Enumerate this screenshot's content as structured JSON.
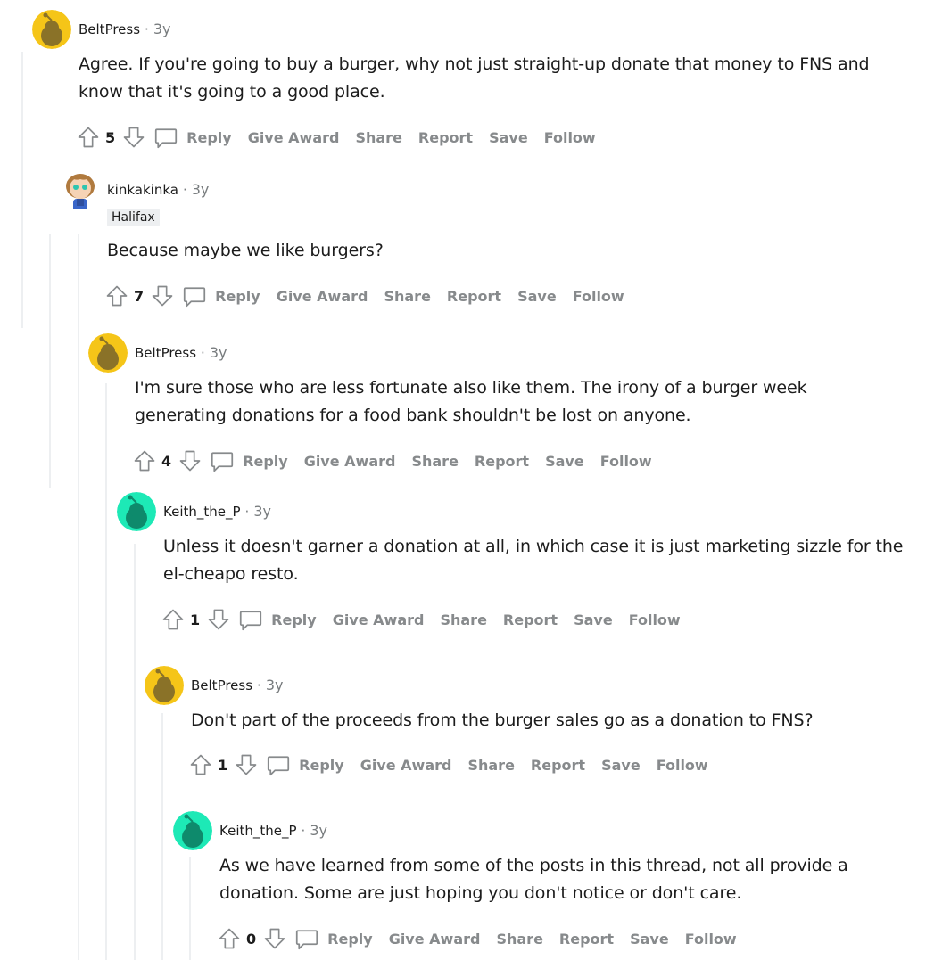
{
  "colors": {
    "avatar_yellow": "#f5c518",
    "avatar_teal": "#1de9b6",
    "thread_line": "#edeff1",
    "action_gray": "#878a8c",
    "meta_gray": "#787c7e"
  },
  "comments": [
    {
      "author": "BeltPress",
      "sep": "·",
      "time": "3y",
      "avatar": "snoo-avatar-yellow",
      "body": "Agree. If you're going to buy a burger, why not just straight-up donate that money to FNS and know that it's going to a good place.",
      "votes": "5",
      "actions": {
        "reply": "Reply",
        "award": "Give Award",
        "share": "Share",
        "report": "Report",
        "save": "Save",
        "follow": "Follow"
      }
    },
    {
      "author": "kinkakinka",
      "sep": "·",
      "time": "3y",
      "avatar": "custom-avatar-girl",
      "flair": "Halifax",
      "body": "Because maybe we like burgers?",
      "votes": "7",
      "actions": {
        "reply": "Reply",
        "award": "Give Award",
        "share": "Share",
        "report": "Report",
        "save": "Save",
        "follow": "Follow"
      }
    },
    {
      "author": "BeltPress",
      "sep": "·",
      "time": "3y",
      "avatar": "snoo-avatar-yellow",
      "body": "I'm sure those who are less fortunate also like them. The irony of a burger week generating donations for a food bank shouldn't be lost on anyone.",
      "votes": "4",
      "actions": {
        "reply": "Reply",
        "award": "Give Award",
        "share": "Share",
        "report": "Report",
        "save": "Save",
        "follow": "Follow"
      }
    },
    {
      "author": "Keith_the_P",
      "sep": "·",
      "time": "3y",
      "avatar": "snoo-avatar-teal",
      "body": "Unless it doesn't garner a donation at all, in which case it is just marketing sizzle for the el-cheapo resto.",
      "votes": "1",
      "actions": {
        "reply": "Reply",
        "award": "Give Award",
        "share": "Share",
        "report": "Report",
        "save": "Save",
        "follow": "Follow"
      }
    },
    {
      "author": "BeltPress",
      "sep": "·",
      "time": "3y",
      "avatar": "snoo-avatar-yellow",
      "body": "Don't part of the proceeds from the burger sales go as a donation to FNS?",
      "votes": "1",
      "actions": {
        "reply": "Reply",
        "award": "Give Award",
        "share": "Share",
        "report": "Report",
        "save": "Save",
        "follow": "Follow"
      }
    },
    {
      "author": "Keith_the_P",
      "sep": "·",
      "time": "3y",
      "avatar": "snoo-avatar-teal",
      "body": "As we have learned from some of the posts in this thread, not all provide a donation. Some are just hoping you don't notice or don't care.",
      "votes": "0",
      "actions": {
        "reply": "Reply",
        "award": "Give Award",
        "share": "Share",
        "report": "Report",
        "save": "Save",
        "follow": "Follow"
      }
    }
  ]
}
